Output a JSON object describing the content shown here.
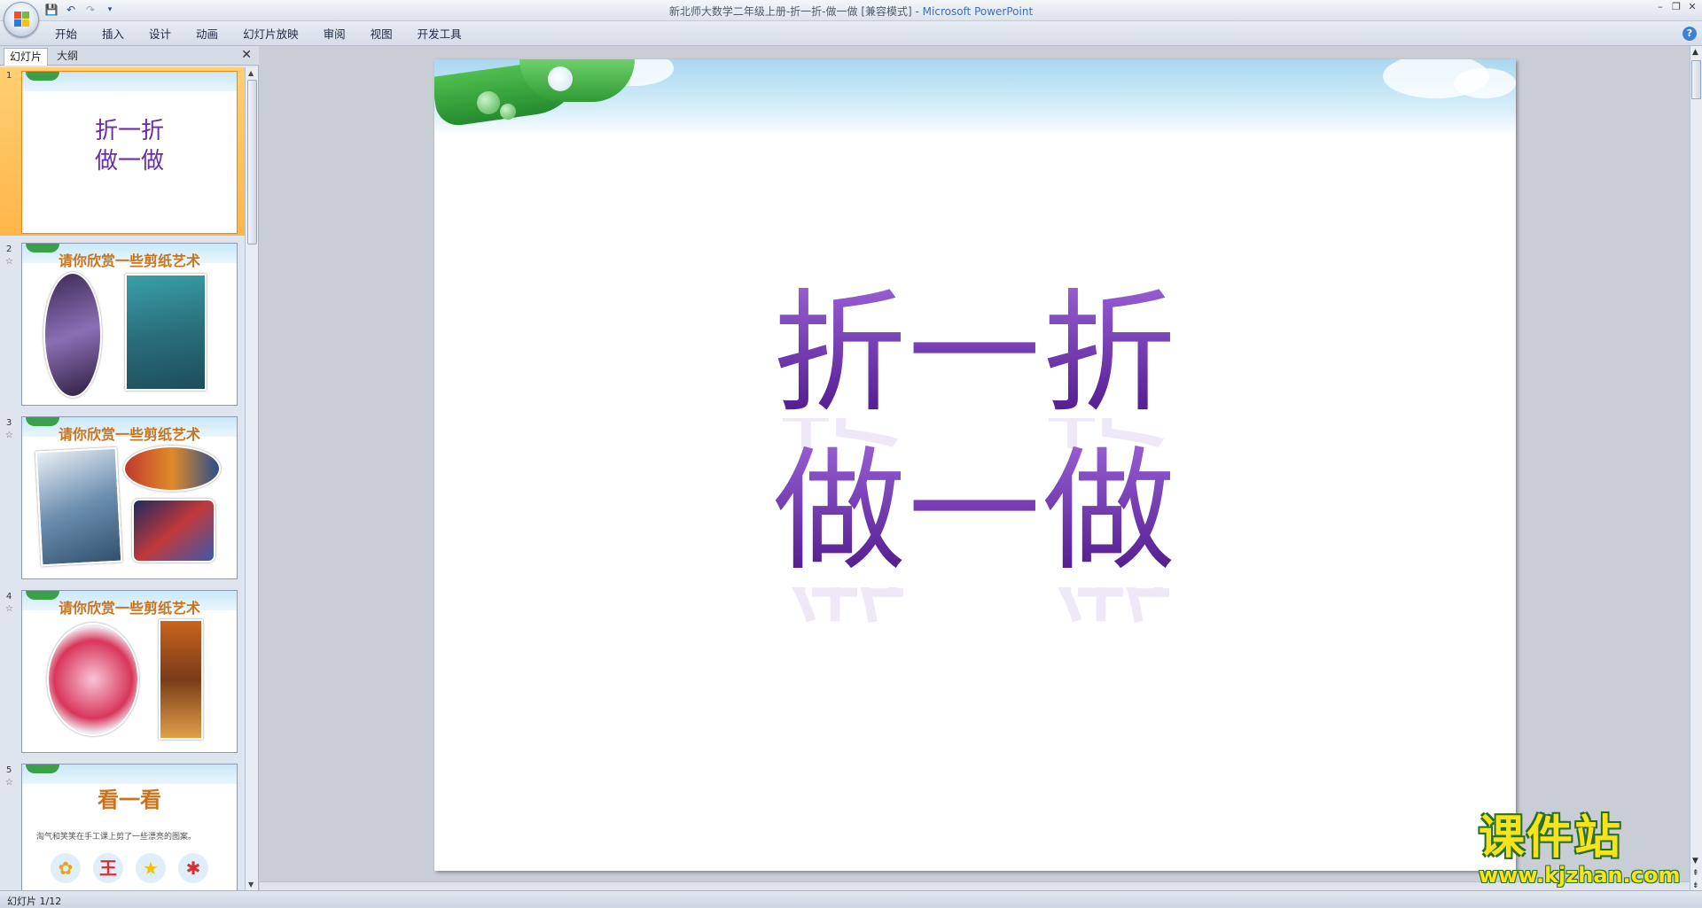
{
  "window": {
    "title": "新北师大数学二年级上册-折一折-做一做 [兼容模式]",
    "app_name": "Microsoft PowerPoint"
  },
  "ribbon": {
    "tabs": [
      "开始",
      "插入",
      "设计",
      "动画",
      "幻灯片放映",
      "审阅",
      "视图",
      "开发工具"
    ],
    "help_label": "?"
  },
  "left_pane": {
    "tabs": {
      "slides": "幻灯片",
      "outline": "大纲"
    },
    "close_label": "✕",
    "thumbnails": [
      {
        "number": "1",
        "title_line1": "折一折",
        "title_line2": "做一做"
      },
      {
        "number": "2",
        "title": "请你欣赏一些剪纸艺术"
      },
      {
        "number": "3",
        "title": "请你欣赏一些剪纸艺术"
      },
      {
        "number": "4",
        "title": "请你欣赏一些剪纸艺术"
      },
      {
        "number": "5",
        "title": "看一看",
        "subtitle": "淘气和笑笑在手工课上剪了一些漂亮的图案。"
      }
    ]
  },
  "slide": {
    "title_line1": "折一折",
    "title_line2": "做一做"
  },
  "watermark": {
    "brand": "课件站",
    "url": "www.kjzhan.com"
  },
  "status": {
    "slide_counter": "幻灯片 1/12"
  },
  "colors": {
    "title_purple": "#6b2db0",
    "thumb_orange": "#c8741e",
    "selection": "#ffb649"
  }
}
